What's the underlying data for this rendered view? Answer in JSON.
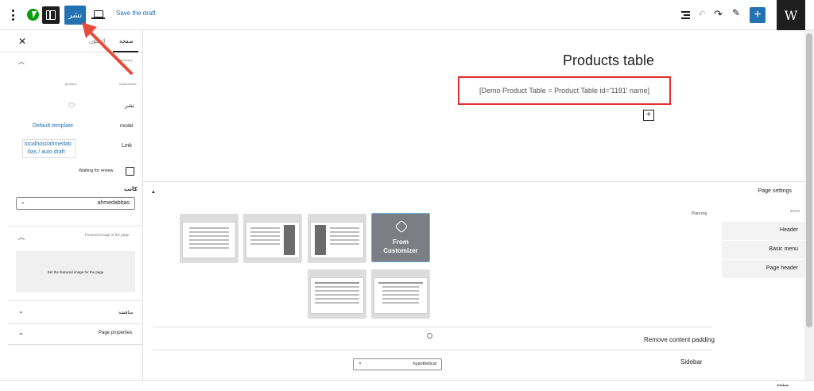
{
  "toolbar": {
    "publish_label": "نشر",
    "save_draft_label": "Save the draft",
    "wp_logo_letter": "W"
  },
  "sidebar": {
    "tabs": {
      "page": "صفحة",
      "block": "المكوّن"
    },
    "summary_label": "summary",
    "tiny_left": "grnnano",
    "tiny_right": "hopscotcher",
    "publish_status_label": "نشر",
    "template_value": "Default template",
    "template_label": "model",
    "link_label": "Link",
    "link_value_line1": "localhost/ahmedab",
    "link_value_line2": "bas / auto draft",
    "pending_review_label": "Waiting for review",
    "author_label": "كاتب",
    "author_value": "ahmedabbas",
    "featured_image_label": "Featured image of the page",
    "featured_image_button": "Set the featured image for the page",
    "discussion_label": "مناقشة",
    "page_properties_label": "Page properties"
  },
  "canvas": {
    "title": "Products table",
    "shortcode": "[Demo Product Table = Product Table id='1181' name]",
    "append_label": "+"
  },
  "meta": {
    "page_settings_title": "Page settings",
    "planning_label": "Planning",
    "tabs": [
      "Header",
      "Basic menu",
      "Page header"
    ],
    "customizer_line1": "From",
    "customizer_line2": "Customizer",
    "remove_padding_label": "Remove content padding",
    "sidebar_label": "Sidebar",
    "sidebar_value": "hypothetical"
  },
  "footer": {
    "breadcrumb": "صفحة"
  },
  "colors": {
    "accent": "#2271b1",
    "highlight_border": "#e0302f",
    "annotation_arrow": "#e74c3c",
    "jetpack_green": "#069e08"
  },
  "icons": [
    "more-vertical-icon",
    "jetpack-icon",
    "sidebar-toggle-icon",
    "desktop-preview-icon",
    "list-view-icon",
    "undo-icon",
    "redo-icon",
    "pencil-icon",
    "plus-icon",
    "close-icon",
    "chevron-up-icon",
    "chevron-down-icon"
  ]
}
